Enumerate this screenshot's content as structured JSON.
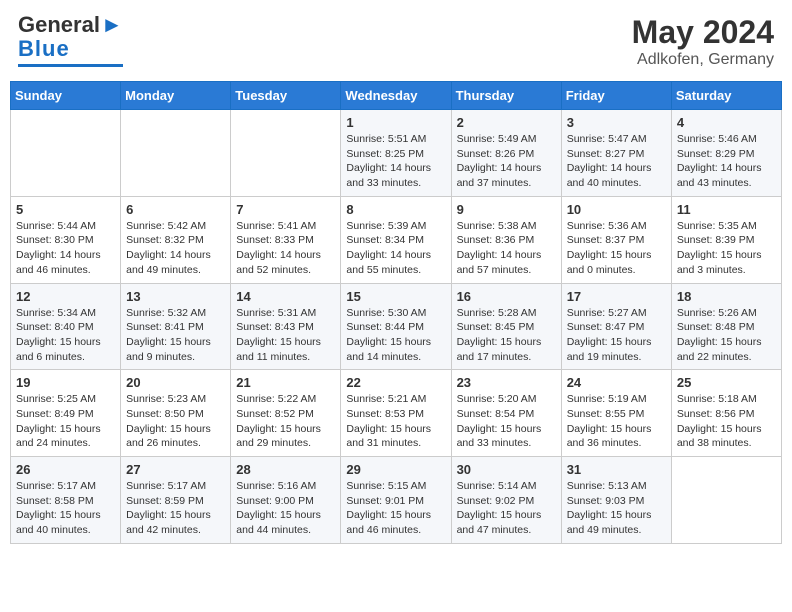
{
  "header": {
    "logo_general": "General",
    "logo_blue": "Blue",
    "month_year": "May 2024",
    "location": "Adlkofen, Germany"
  },
  "weekdays": [
    "Sunday",
    "Monday",
    "Tuesday",
    "Wednesday",
    "Thursday",
    "Friday",
    "Saturday"
  ],
  "weeks": [
    [
      {
        "day": "",
        "sunrise": "",
        "sunset": "",
        "daylight": ""
      },
      {
        "day": "",
        "sunrise": "",
        "sunset": "",
        "daylight": ""
      },
      {
        "day": "",
        "sunrise": "",
        "sunset": "",
        "daylight": ""
      },
      {
        "day": "1",
        "sunrise": "Sunrise: 5:51 AM",
        "sunset": "Sunset: 8:25 PM",
        "daylight": "Daylight: 14 hours and 33 minutes."
      },
      {
        "day": "2",
        "sunrise": "Sunrise: 5:49 AM",
        "sunset": "Sunset: 8:26 PM",
        "daylight": "Daylight: 14 hours and 37 minutes."
      },
      {
        "day": "3",
        "sunrise": "Sunrise: 5:47 AM",
        "sunset": "Sunset: 8:27 PM",
        "daylight": "Daylight: 14 hours and 40 minutes."
      },
      {
        "day": "4",
        "sunrise": "Sunrise: 5:46 AM",
        "sunset": "Sunset: 8:29 PM",
        "daylight": "Daylight: 14 hours and 43 minutes."
      }
    ],
    [
      {
        "day": "5",
        "sunrise": "Sunrise: 5:44 AM",
        "sunset": "Sunset: 8:30 PM",
        "daylight": "Daylight: 14 hours and 46 minutes."
      },
      {
        "day": "6",
        "sunrise": "Sunrise: 5:42 AM",
        "sunset": "Sunset: 8:32 PM",
        "daylight": "Daylight: 14 hours and 49 minutes."
      },
      {
        "day": "7",
        "sunrise": "Sunrise: 5:41 AM",
        "sunset": "Sunset: 8:33 PM",
        "daylight": "Daylight: 14 hours and 52 minutes."
      },
      {
        "day": "8",
        "sunrise": "Sunrise: 5:39 AM",
        "sunset": "Sunset: 8:34 PM",
        "daylight": "Daylight: 14 hours and 55 minutes."
      },
      {
        "day": "9",
        "sunrise": "Sunrise: 5:38 AM",
        "sunset": "Sunset: 8:36 PM",
        "daylight": "Daylight: 14 hours and 57 minutes."
      },
      {
        "day": "10",
        "sunrise": "Sunrise: 5:36 AM",
        "sunset": "Sunset: 8:37 PM",
        "daylight": "Daylight: 15 hours and 0 minutes."
      },
      {
        "day": "11",
        "sunrise": "Sunrise: 5:35 AM",
        "sunset": "Sunset: 8:39 PM",
        "daylight": "Daylight: 15 hours and 3 minutes."
      }
    ],
    [
      {
        "day": "12",
        "sunrise": "Sunrise: 5:34 AM",
        "sunset": "Sunset: 8:40 PM",
        "daylight": "Daylight: 15 hours and 6 minutes."
      },
      {
        "day": "13",
        "sunrise": "Sunrise: 5:32 AM",
        "sunset": "Sunset: 8:41 PM",
        "daylight": "Daylight: 15 hours and 9 minutes."
      },
      {
        "day": "14",
        "sunrise": "Sunrise: 5:31 AM",
        "sunset": "Sunset: 8:43 PM",
        "daylight": "Daylight: 15 hours and 11 minutes."
      },
      {
        "day": "15",
        "sunrise": "Sunrise: 5:30 AM",
        "sunset": "Sunset: 8:44 PM",
        "daylight": "Daylight: 15 hours and 14 minutes."
      },
      {
        "day": "16",
        "sunrise": "Sunrise: 5:28 AM",
        "sunset": "Sunset: 8:45 PM",
        "daylight": "Daylight: 15 hours and 17 minutes."
      },
      {
        "day": "17",
        "sunrise": "Sunrise: 5:27 AM",
        "sunset": "Sunset: 8:47 PM",
        "daylight": "Daylight: 15 hours and 19 minutes."
      },
      {
        "day": "18",
        "sunrise": "Sunrise: 5:26 AM",
        "sunset": "Sunset: 8:48 PM",
        "daylight": "Daylight: 15 hours and 22 minutes."
      }
    ],
    [
      {
        "day": "19",
        "sunrise": "Sunrise: 5:25 AM",
        "sunset": "Sunset: 8:49 PM",
        "daylight": "Daylight: 15 hours and 24 minutes."
      },
      {
        "day": "20",
        "sunrise": "Sunrise: 5:23 AM",
        "sunset": "Sunset: 8:50 PM",
        "daylight": "Daylight: 15 hours and 26 minutes."
      },
      {
        "day": "21",
        "sunrise": "Sunrise: 5:22 AM",
        "sunset": "Sunset: 8:52 PM",
        "daylight": "Daylight: 15 hours and 29 minutes."
      },
      {
        "day": "22",
        "sunrise": "Sunrise: 5:21 AM",
        "sunset": "Sunset: 8:53 PM",
        "daylight": "Daylight: 15 hours and 31 minutes."
      },
      {
        "day": "23",
        "sunrise": "Sunrise: 5:20 AM",
        "sunset": "Sunset: 8:54 PM",
        "daylight": "Daylight: 15 hours and 33 minutes."
      },
      {
        "day": "24",
        "sunrise": "Sunrise: 5:19 AM",
        "sunset": "Sunset: 8:55 PM",
        "daylight": "Daylight: 15 hours and 36 minutes."
      },
      {
        "day": "25",
        "sunrise": "Sunrise: 5:18 AM",
        "sunset": "Sunset: 8:56 PM",
        "daylight": "Daylight: 15 hours and 38 minutes."
      }
    ],
    [
      {
        "day": "26",
        "sunrise": "Sunrise: 5:17 AM",
        "sunset": "Sunset: 8:58 PM",
        "daylight": "Daylight: 15 hours and 40 minutes."
      },
      {
        "day": "27",
        "sunrise": "Sunrise: 5:17 AM",
        "sunset": "Sunset: 8:59 PM",
        "daylight": "Daylight: 15 hours and 42 minutes."
      },
      {
        "day": "28",
        "sunrise": "Sunrise: 5:16 AM",
        "sunset": "Sunset: 9:00 PM",
        "daylight": "Daylight: 15 hours and 44 minutes."
      },
      {
        "day": "29",
        "sunrise": "Sunrise: 5:15 AM",
        "sunset": "Sunset: 9:01 PM",
        "daylight": "Daylight: 15 hours and 46 minutes."
      },
      {
        "day": "30",
        "sunrise": "Sunrise: 5:14 AM",
        "sunset": "Sunset: 9:02 PM",
        "daylight": "Daylight: 15 hours and 47 minutes."
      },
      {
        "day": "31",
        "sunrise": "Sunrise: 5:13 AM",
        "sunset": "Sunset: 9:03 PM",
        "daylight": "Daylight: 15 hours and 49 minutes."
      },
      {
        "day": "",
        "sunrise": "",
        "sunset": "",
        "daylight": ""
      }
    ]
  ]
}
